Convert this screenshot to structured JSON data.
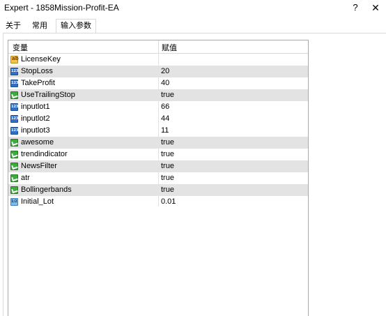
{
  "window": {
    "title": "Expert - 1858Mission-Profit-EA",
    "help_label": "?",
    "close_label": "✕"
  },
  "tabs": [
    {
      "label": "关于",
      "active": false
    },
    {
      "label": "常用",
      "active": false
    },
    {
      "label": "输入参数",
      "active": true
    }
  ],
  "table": {
    "headers": {
      "variable": "变量",
      "value": "赋值"
    },
    "rows": [
      {
        "name": "LicenseKey",
        "value": "",
        "icon": "string-icon"
      },
      {
        "name": "StopLoss",
        "value": "20",
        "icon": "integer-icon"
      },
      {
        "name": "TakeProfit",
        "value": "40",
        "icon": "integer-icon"
      },
      {
        "name": "UseTrailingStop",
        "value": "true",
        "icon": "bool-icon"
      },
      {
        "name": "inputlot1",
        "value": "66",
        "icon": "integer-icon"
      },
      {
        "name": "inputlot2",
        "value": "44",
        "icon": "integer-icon"
      },
      {
        "name": "inputlot3",
        "value": "11",
        "icon": "integer-icon"
      },
      {
        "name": "awesome",
        "value": "true",
        "icon": "bool-icon"
      },
      {
        "name": "trendindicator",
        "value": "true",
        "icon": "bool-icon"
      },
      {
        "name": "NewsFilter",
        "value": "true",
        "icon": "bool-icon"
      },
      {
        "name": "atr",
        "value": "true",
        "icon": "bool-icon"
      },
      {
        "name": "Bollingerbands",
        "value": "true",
        "icon": "bool-icon"
      },
      {
        "name": "Initial_Lot",
        "value": "0.01",
        "icon": "double-icon"
      }
    ]
  }
}
